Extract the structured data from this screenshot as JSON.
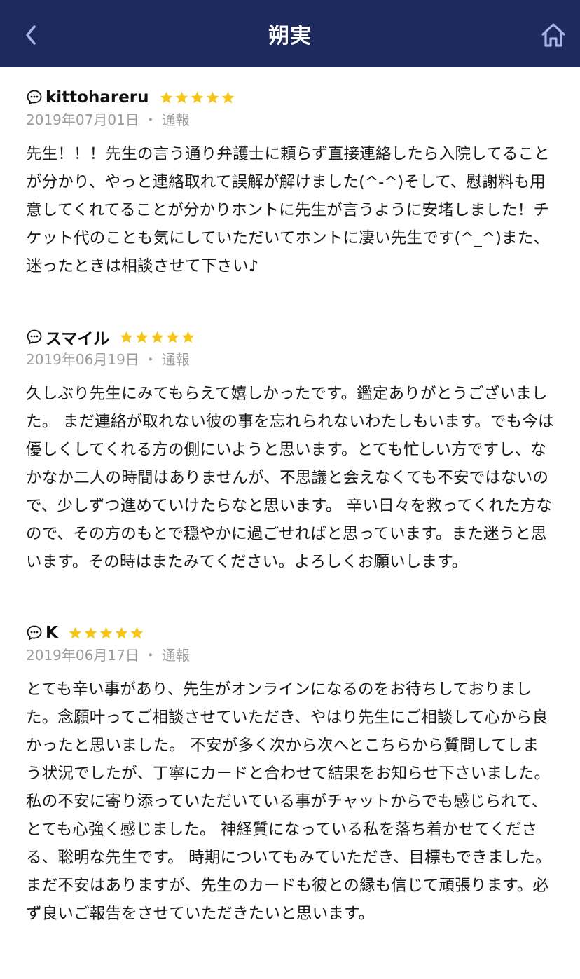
{
  "header": {
    "title": "朔実",
    "back_icon": "chevron-left-icon",
    "home_icon": "home-icon",
    "bg_color": "#1e2a5e"
  },
  "reviews": [
    {
      "name": "kittohareru",
      "rating": 5,
      "date": "2019年07月01日",
      "separator": "・",
      "report_label": "通報",
      "text": "先生！！！先生の言う通り弁護士に頼らず直接連絡したら入院してることが分かり、やっと連絡取れて誤解が解けました(^-^)そして、慰謝料も用意してくれてることが分かりホントに先生が言うように安堵しました！チケット代のことも気にしていただいてホントに凄い先生です(^_^)また、迷ったときは相談させて下さい♪"
    },
    {
      "name": "スマイル",
      "rating": 5,
      "date": "2019年06月19日",
      "separator": "・",
      "report_label": "通報",
      "text": "久しぶり先生にみてもらえて嬉しかったです。鑑定ありがとうございました。 まだ連絡が取れない彼の事を忘れられないわたしもいます。でも今は優しくしてくれる方の側にいようと思います。とても忙しい方ですし、なかなか二人の時間はありませんが、不思議と会えなくても不安ではないので、少しずつ進めていけたらなと思います。 辛い日々を救ってくれた方なので、その方のもとで穏やかに過ごせればと思っています。また迷うと思います。その時はまたみてください。よろしくお願いします。"
    },
    {
      "name": "K",
      "rating": 5,
      "date": "2019年06月17日",
      "separator": "・",
      "report_label": "通報",
      "text": "とても辛い事があり、先生がオンラインになるのをお待ちしておりました。念願叶ってご相談させていただき、やはり先生にご相談して心から良かったと思いました。 不安が多く次から次へとこちらから質問してしまう状況でしたが、丁寧にカードと合わせて結果をお知らせ下さいました。私の不安に寄り添っていただいている事がチャットからでも感じられて、とても心強く感じました。 神経質になっている私を落ち着かせてくださる、聡明な先生です。 時期についてもみていただき、目標もできました。 まだ不安はありますが、先生のカードも彼との縁も信じて頑張ります。必ず良いご報告をさせていただきたいと思います。"
    }
  ],
  "colors": {
    "star": "#f5c518",
    "meta": "#9b9b9b"
  }
}
